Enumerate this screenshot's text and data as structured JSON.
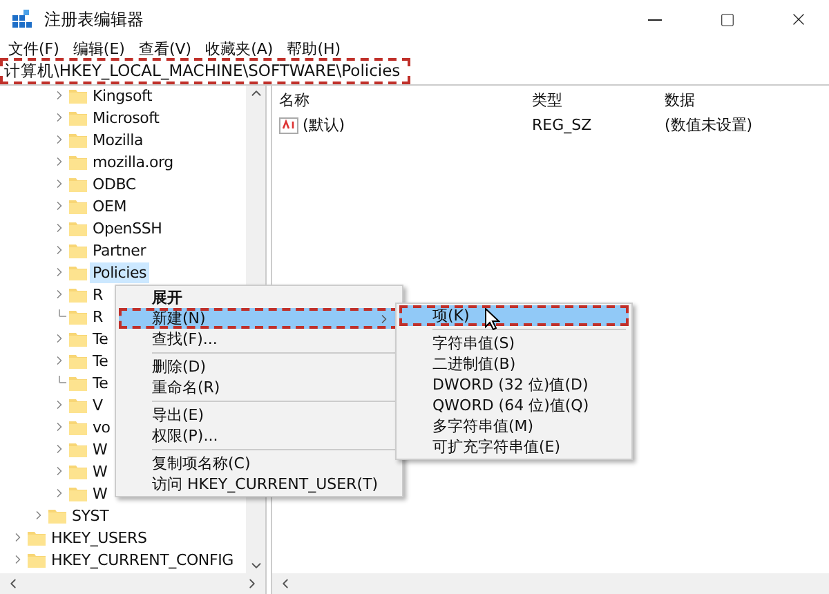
{
  "window": {
    "title": "注册表编辑器"
  },
  "menu_bar": [
    {
      "label": "文件(F)"
    },
    {
      "label": "编辑(E)"
    },
    {
      "label": "查看(V)"
    },
    {
      "label": "收藏夹(A)"
    },
    {
      "label": "帮助(H)"
    }
  ],
  "address": {
    "path": "计算机\\HKEY_LOCAL_MACHINE\\SOFTWARE\\Policies",
    "annotated": true
  },
  "tree": {
    "items": [
      {
        "children": [
          {
            "children": [
              {
                "label": "Kingsoft",
                "expandable": true,
                "selected": false
              },
              {
                "label": "Microsoft",
                "expandable": true,
                "selected": false
              },
              {
                "label": "Mozilla",
                "expandable": true,
                "selected": false
              },
              {
                "label": "mozilla.org",
                "expandable": true,
                "selected": false
              },
              {
                "label": "ODBC",
                "expandable": true,
                "selected": false
              },
              {
                "label": "OEM",
                "expandable": true,
                "selected": false
              },
              {
                "label": "OpenSSH",
                "expandable": true,
                "selected": false
              },
              {
                "label": "Partner",
                "expandable": true,
                "selected": false
              },
              {
                "label": "Policies",
                "expandable": true,
                "selected": true
              },
              {
                "label": "R",
                "expandable": true,
                "selected": false
              },
              {
                "label": "R",
                "expandable": false,
                "selected": false
              },
              {
                "label": "Te",
                "expandable": true,
                "selected": false
              },
              {
                "label": "Te",
                "expandable": true,
                "selected": false
              },
              {
                "label": "Te",
                "expandable": false,
                "selected": false
              },
              {
                "label": "V",
                "expandable": true,
                "selected": false
              },
              {
                "label": "vo",
                "expandable": true,
                "selected": false
              },
              {
                "label": "W",
                "expandable": true,
                "selected": false
              },
              {
                "label": "W",
                "expandable": true,
                "selected": false
              },
              {
                "label": "W",
                "expandable": true,
                "selected": false
              }
            ]
          },
          {
            "label": "SYST",
            "expandable": true,
            "selected": false
          }
        ]
      },
      {
        "label": "HKEY_USERS",
        "expandable": true,
        "selected": false
      },
      {
        "label": "HKEY_CURRENT_CONFIG",
        "expandable": true,
        "selected": false
      }
    ]
  },
  "values": {
    "columns": [
      "名称",
      "类型",
      "数据"
    ],
    "rows": [
      {
        "name": "(默认)",
        "type": "REG_SZ",
        "data": "(数值未设置)"
      }
    ]
  },
  "context_menu": {
    "items": [
      {
        "kind": "item",
        "label": "展开",
        "default": true,
        "selected": false,
        "submenu": false,
        "annotated": false
      },
      {
        "kind": "item",
        "label": "新建(N)",
        "default": false,
        "selected": true,
        "submenu": true,
        "annotated": true
      },
      {
        "kind": "item",
        "label": "查找(F)...",
        "default": false,
        "selected": false,
        "submenu": false,
        "annotated": false
      },
      {
        "kind": "separator"
      },
      {
        "kind": "item",
        "label": "删除(D)",
        "default": false,
        "selected": false,
        "submenu": false,
        "annotated": false
      },
      {
        "kind": "item",
        "label": "重命名(R)",
        "default": false,
        "selected": false,
        "submenu": false,
        "annotated": false
      },
      {
        "kind": "separator"
      },
      {
        "kind": "item",
        "label": "导出(E)",
        "default": false,
        "selected": false,
        "submenu": false,
        "annotated": false
      },
      {
        "kind": "item",
        "label": "权限(P)...",
        "default": false,
        "selected": false,
        "submenu": false,
        "annotated": false
      },
      {
        "kind": "separator"
      },
      {
        "kind": "item",
        "label": "复制项名称(C)",
        "default": false,
        "selected": false,
        "submenu": false,
        "annotated": false
      },
      {
        "kind": "item",
        "label": "访问 HKEY_CURRENT_USER(T)",
        "default": false,
        "selected": false,
        "submenu": false,
        "annotated": false
      }
    ]
  },
  "submenu": {
    "items": [
      {
        "kind": "item",
        "label": "项(K)",
        "selected": true,
        "annotated": true
      },
      {
        "kind": "separator"
      },
      {
        "kind": "item",
        "label": "字符串值(S)",
        "selected": false,
        "annotated": false
      },
      {
        "kind": "item",
        "label": "二进制值(B)",
        "selected": false,
        "annotated": false
      },
      {
        "kind": "item",
        "label": "DWORD (32 位)值(D)",
        "selected": false,
        "annotated": false
      },
      {
        "kind": "item",
        "label": "QWORD (64 位)值(Q)",
        "selected": false,
        "annotated": false
      },
      {
        "kind": "item",
        "label": "多字符串值(M)",
        "selected": false,
        "annotated": false
      },
      {
        "kind": "item",
        "label": "可扩充字符串值(E)",
        "selected": false,
        "annotated": false
      }
    ]
  }
}
